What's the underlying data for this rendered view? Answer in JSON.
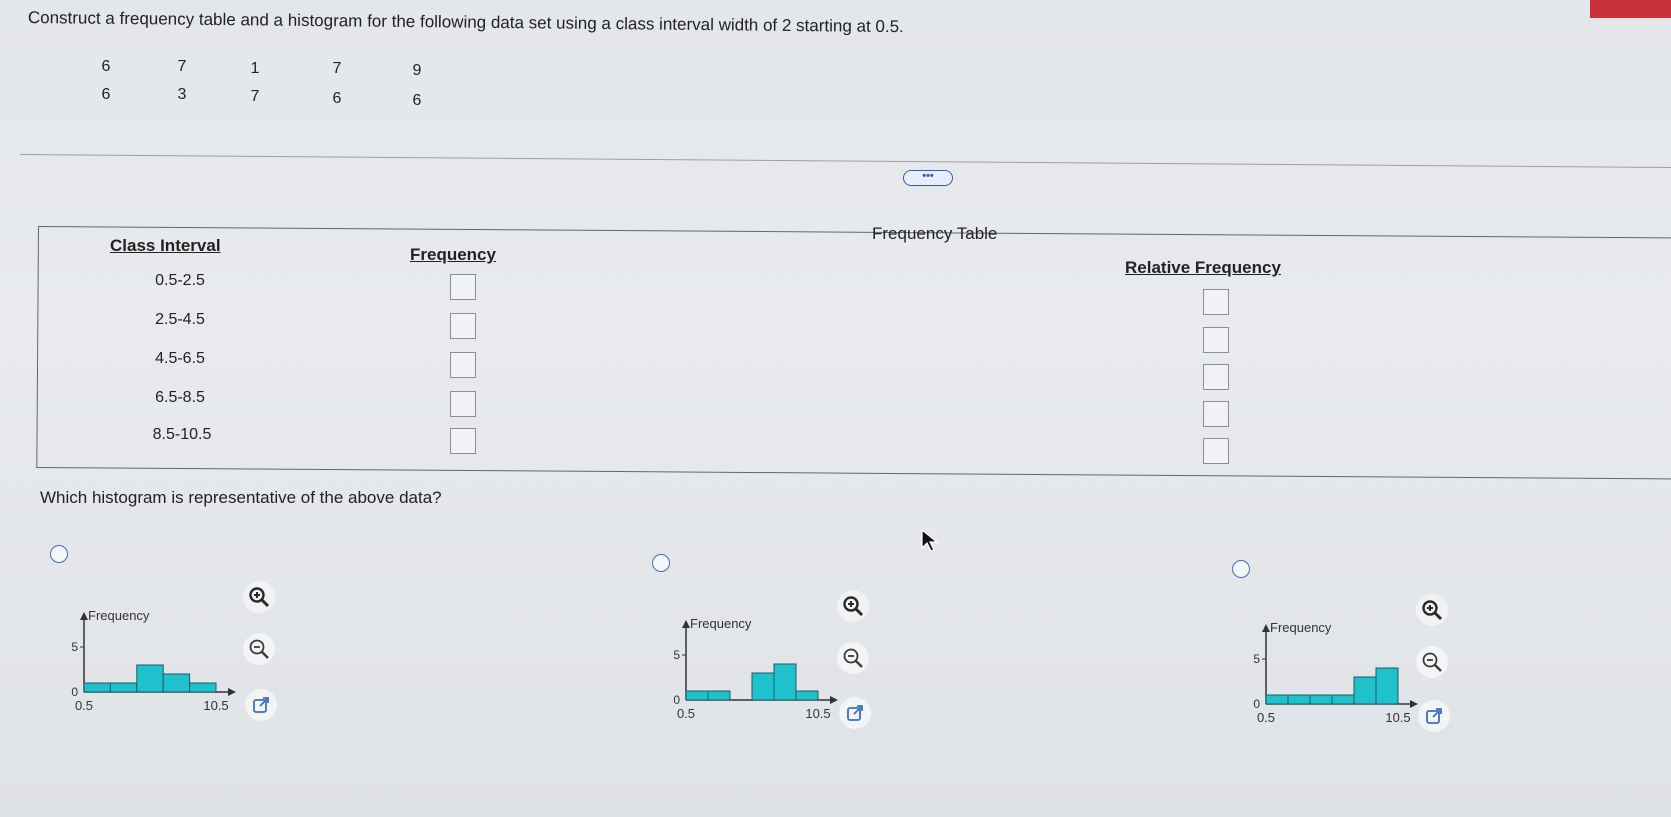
{
  "question": "Construct a frequency table and a histogram for the following data set using a class interval width of 2 starting at 0.5.",
  "data_set": {
    "row1": [
      "6",
      "7",
      "1",
      "7",
      "9"
    ],
    "row2": [
      "6",
      "3",
      "7",
      "6",
      "6"
    ]
  },
  "more_button": "•••",
  "table": {
    "title": "Frequency Table",
    "col_class": "Class Interval",
    "col_freq": "Frequency",
    "col_rel": "Relative Frequency",
    "intervals": [
      "0.5-2.5",
      "2.5-4.5",
      "4.5-6.5",
      "6.5-8.5",
      "8.5-10.5"
    ]
  },
  "histogram_question": "Which histogram is representative of the above data?",
  "histograms": [
    {
      "ylabel": "Frequency",
      "ytick_top": "5",
      "ytick_zero": "0",
      "x_start": "0.5",
      "x_end": "10.5",
      "values": [
        1,
        1,
        3,
        2,
        1
      ],
      "bar_color": "#1fc2cc"
    },
    {
      "ylabel": "Frequency",
      "ytick_top": "5",
      "ytick_zero": "0",
      "x_start": "0.5",
      "x_end": "10.5",
      "values": [
        1,
        1,
        0,
        3,
        4,
        1
      ],
      "bar_color": "#1fc2cc"
    },
    {
      "ylabel": "Frequency",
      "ytick_top": "5",
      "ytick_zero": "0",
      "x_start": "0.5",
      "x_end": "10.5",
      "values": [
        1,
        1,
        1,
        1,
        3,
        4
      ],
      "bar_color": "#1fc2cc"
    }
  ],
  "colors": {
    "accent": "#3f6fb8",
    "bars": "#1fc2cc",
    "top_bar": "#c8333a"
  },
  "icons": [
    "zoom-in-icon",
    "zoom-out-icon",
    "popout-icon",
    "cursor-icon"
  ]
}
